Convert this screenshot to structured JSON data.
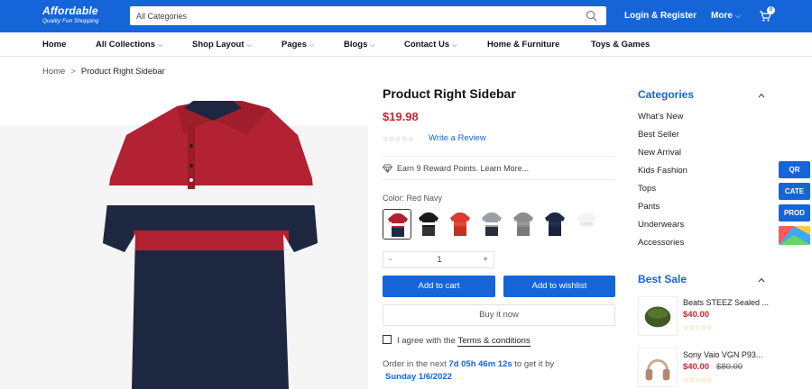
{
  "header": {
    "logo_name": "Affordable",
    "logo_tagline": "Quality Fun Shopping",
    "search_placeholder": "All Categories",
    "login_label": "Login & Register",
    "more_label": "More",
    "cart_count": "0"
  },
  "nav": {
    "items": [
      {
        "label": "Home",
        "has_dropdown": false
      },
      {
        "label": "All Collections",
        "has_dropdown": true
      },
      {
        "label": "Shop Layout",
        "has_dropdown": true
      },
      {
        "label": "Pages",
        "has_dropdown": true
      },
      {
        "label": "Blogs",
        "has_dropdown": true
      },
      {
        "label": "Contact Us",
        "has_dropdown": true
      },
      {
        "label": "Home & Furniture",
        "has_dropdown": false
      },
      {
        "label": "Toys & Games",
        "has_dropdown": false
      }
    ]
  },
  "breadcrumb": {
    "home": "Home",
    "separator": ">",
    "current": "Product Right Sidebar"
  },
  "product": {
    "title": "Product Right Sidebar",
    "price": "$19.98",
    "stars": "☆☆☆☆☆",
    "review_link": "Write a Review",
    "reward_text": "Earn 9 Reward Points. Learn More...",
    "color_label": "Color: Red Navy",
    "swatches": [
      {
        "name": "red-navy",
        "colors": [
          "#b02030",
          "#ffffff",
          "#1e2a44"
        ],
        "selected": true
      },
      {
        "name": "black",
        "colors": [
          "#1a1a1a",
          "#ffffff",
          "#333333"
        ],
        "selected": false
      },
      {
        "name": "red",
        "colors": [
          "#d83a2c",
          "#e24b3b",
          "#c52e22"
        ],
        "selected": false
      },
      {
        "name": "grey-stripe",
        "colors": [
          "#9aa0a6",
          "#ffffff",
          "#2a2e36"
        ],
        "selected": false
      },
      {
        "name": "grey",
        "colors": [
          "#8c8c8c",
          "#9a9a9a",
          "#7a7a7a"
        ],
        "selected": false
      },
      {
        "name": "navy",
        "colors": [
          "#1e2a44",
          "#26324f",
          "#18223a"
        ],
        "selected": false
      },
      {
        "name": "white",
        "colors": [
          "#f4f4f4",
          "#e6e6e6",
          "#ffffff"
        ],
        "selected": false
      }
    ],
    "quantity": {
      "minus": "-",
      "value": "1",
      "plus": "+"
    },
    "add_to_cart": "Add to cart",
    "add_to_wishlist": "Add to wishlist",
    "buy_now": "Buy it now",
    "agree_prefix": "I agree with the",
    "terms_link": "Terms & conditions",
    "order_prefix": "Order in the next",
    "countdown": "7d 05h 46m 12s",
    "order_suffix": "to get it by",
    "delivery_date": "Sunday 1/6/2022"
  },
  "sidebar": {
    "categories_title": "Categories",
    "categories": [
      "What's New",
      "Best Seller",
      "New Arrival",
      "Kids Fashion",
      "Tops",
      "Pants",
      "Underwears",
      "Accessories"
    ],
    "best_sale_title": "Best Sale",
    "best_sale": [
      {
        "name": "Beats STEEZ Sealed ...",
        "price": "$40.00",
        "old_price": "",
        "stars": "☆☆☆☆☆",
        "image": "speaker"
      },
      {
        "name": "Sony Vaio VGN P93...",
        "price": "$40.00",
        "old_price": "$80.00",
        "stars": "☆☆☆☆☆",
        "image": "headphones"
      }
    ]
  },
  "floating_tools": [
    "QR",
    "CATE",
    "PROD"
  ],
  "colors": {
    "brand_blue": "#1565d8",
    "price_red": "#d0252e"
  }
}
